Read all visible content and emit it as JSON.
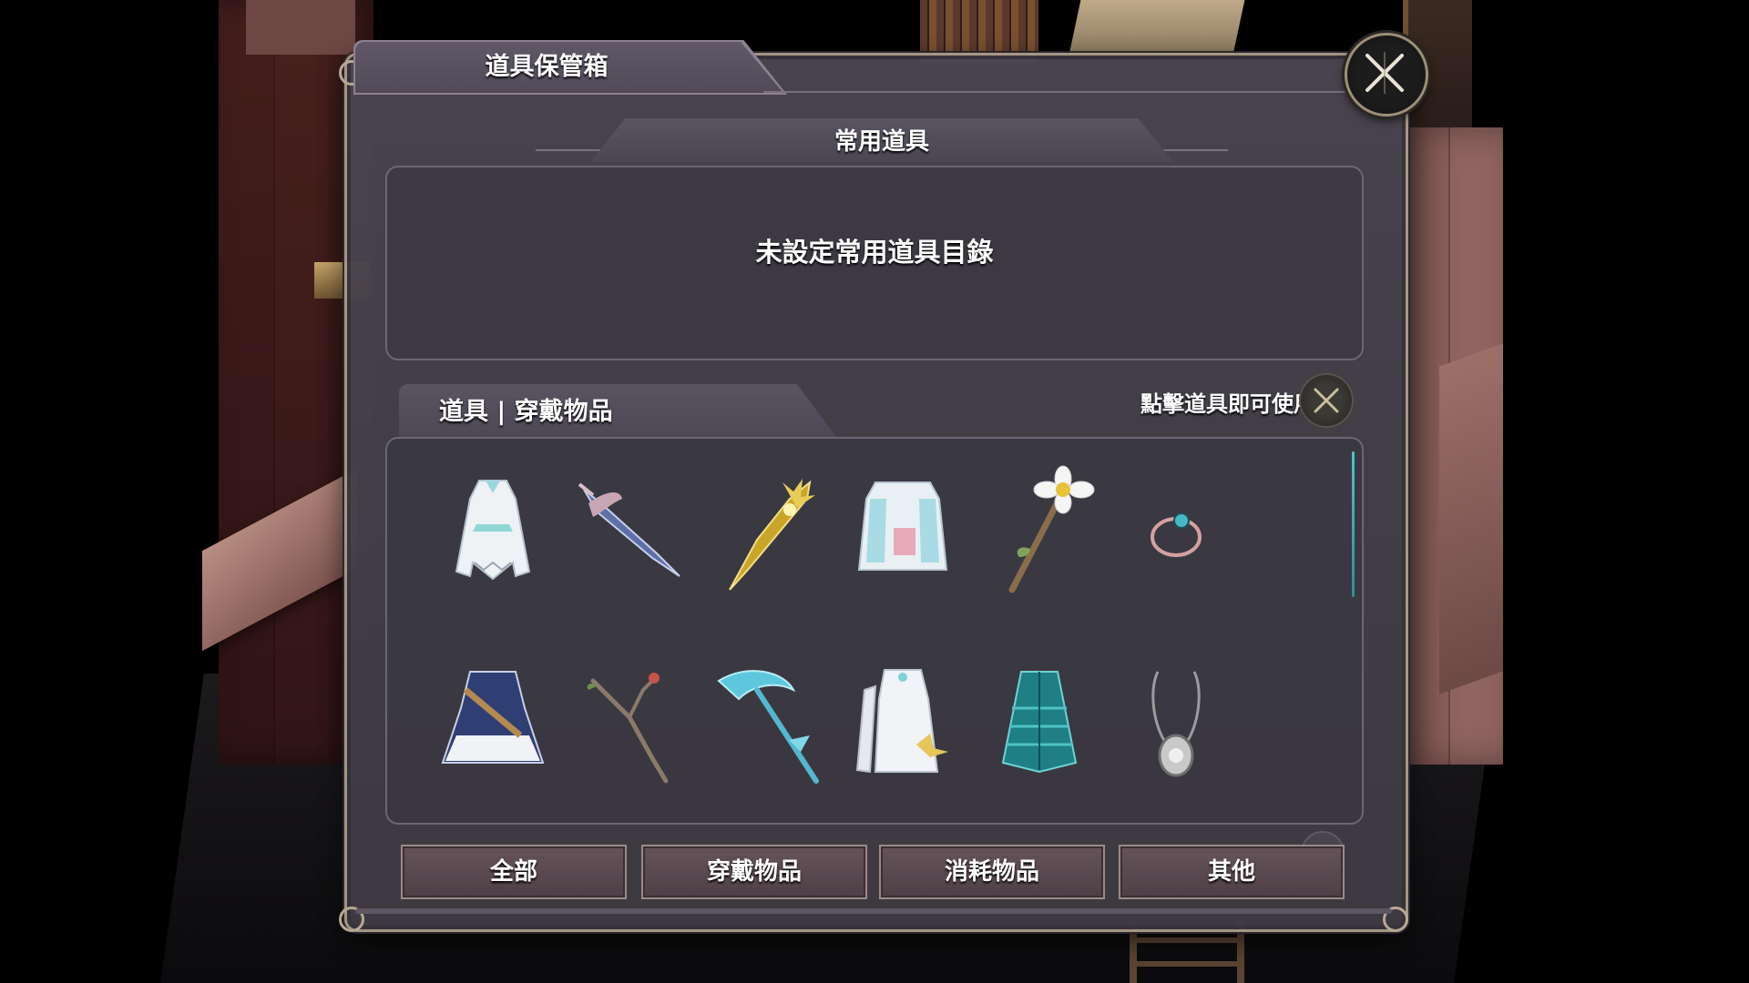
{
  "window": {
    "title": "道具保管箱"
  },
  "favorites": {
    "header": "常用道具",
    "empty_message": "未設定常用道具目錄"
  },
  "items_section": {
    "header": "道具 | 穿戴物品",
    "hint": "點擊道具即可使用"
  },
  "items": [
    {
      "icon": "white-robe-icon"
    },
    {
      "icon": "blue-blade-icon"
    },
    {
      "icon": "golden-blade-icon"
    },
    {
      "icon": "white-hooded-coat-icon"
    },
    {
      "icon": "flower-staff-icon"
    },
    {
      "icon": "ring-icon"
    },
    {
      "icon": "navy-dress-icon"
    },
    {
      "icon": "branch-staff-icon"
    },
    {
      "icon": "ice-scythe-icon"
    },
    {
      "icon": "white-armor-dress-icon"
    },
    {
      "icon": "teal-feather-cloak-icon"
    },
    {
      "icon": "amulet-icon"
    }
  ],
  "filter_tabs": [
    "全部",
    "穿戴物品",
    "消耗物品",
    "其他"
  ],
  "colors": {
    "panel": "#45414a",
    "border": "#a99a88",
    "accent_teal": "#4fc3c5",
    "tab_button": "#5b4a51"
  }
}
